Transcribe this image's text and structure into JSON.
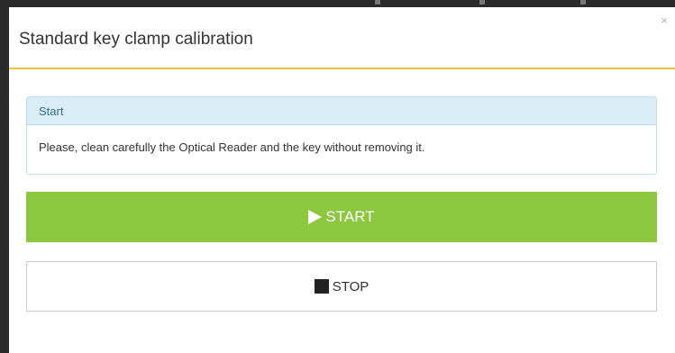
{
  "modal": {
    "title": "Standard key clamp calibration",
    "close_label": "×"
  },
  "panel": {
    "heading": "Start",
    "message": "Please, clean carefully the Optical Reader and the key without removing it."
  },
  "buttons": {
    "start_label": "START",
    "stop_label": "STOP"
  },
  "colors": {
    "start_button": "#8dc63f",
    "header_border": "#f0c24b",
    "panel_heading_bg": "#d9edf7",
    "panel_heading_text": "#31708f"
  },
  "icons": {
    "start": "play-icon",
    "stop": "stop-icon",
    "close": "close-icon"
  }
}
